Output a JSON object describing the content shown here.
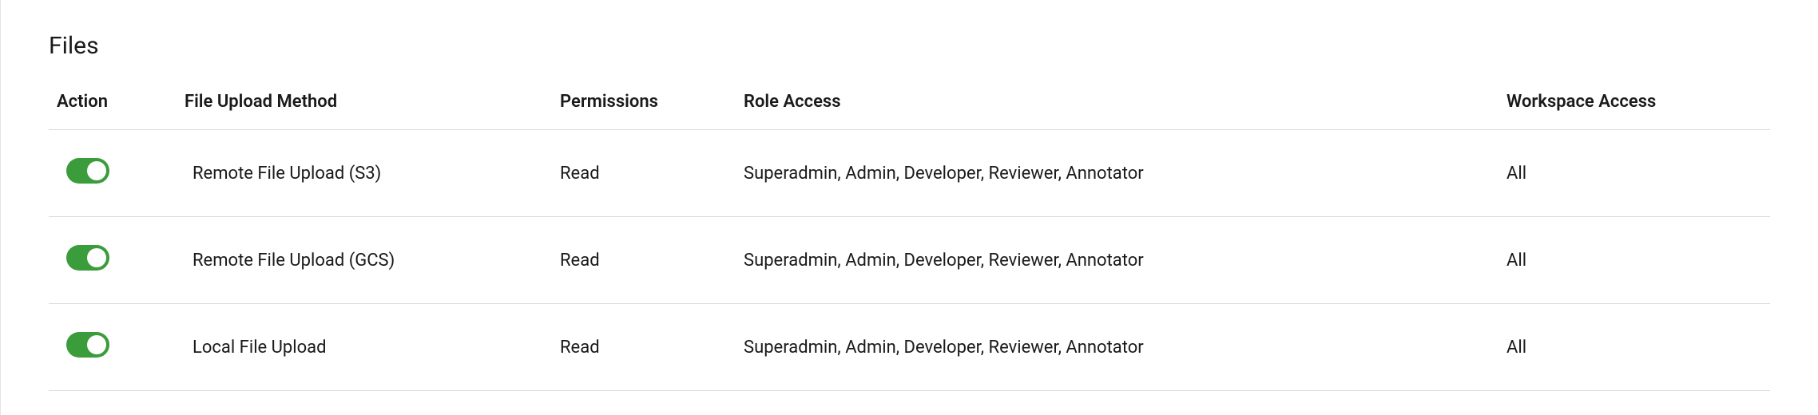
{
  "section_title": "Files",
  "headers": {
    "action": "Action",
    "method": "File Upload Method",
    "permissions": "Permissions",
    "role_access": "Role Access",
    "workspace_access": "Workspace Access"
  },
  "rows": [
    {
      "enabled": true,
      "method": "Remote File Upload (S3)",
      "permissions": "Read",
      "role_access": "Superadmin, Admin, Developer, Reviewer, Annotator",
      "workspace_access": "All"
    },
    {
      "enabled": true,
      "method": "Remote File Upload (GCS)",
      "permissions": "Read",
      "role_access": "Superadmin, Admin, Developer, Reviewer, Annotator",
      "workspace_access": "All"
    },
    {
      "enabled": true,
      "method": "Local File Upload",
      "permissions": "Read",
      "role_access": "Superadmin, Admin, Developer, Reviewer, Annotator",
      "workspace_access": "All"
    }
  ],
  "colors": {
    "toggle_on": "#3a9c3a"
  }
}
